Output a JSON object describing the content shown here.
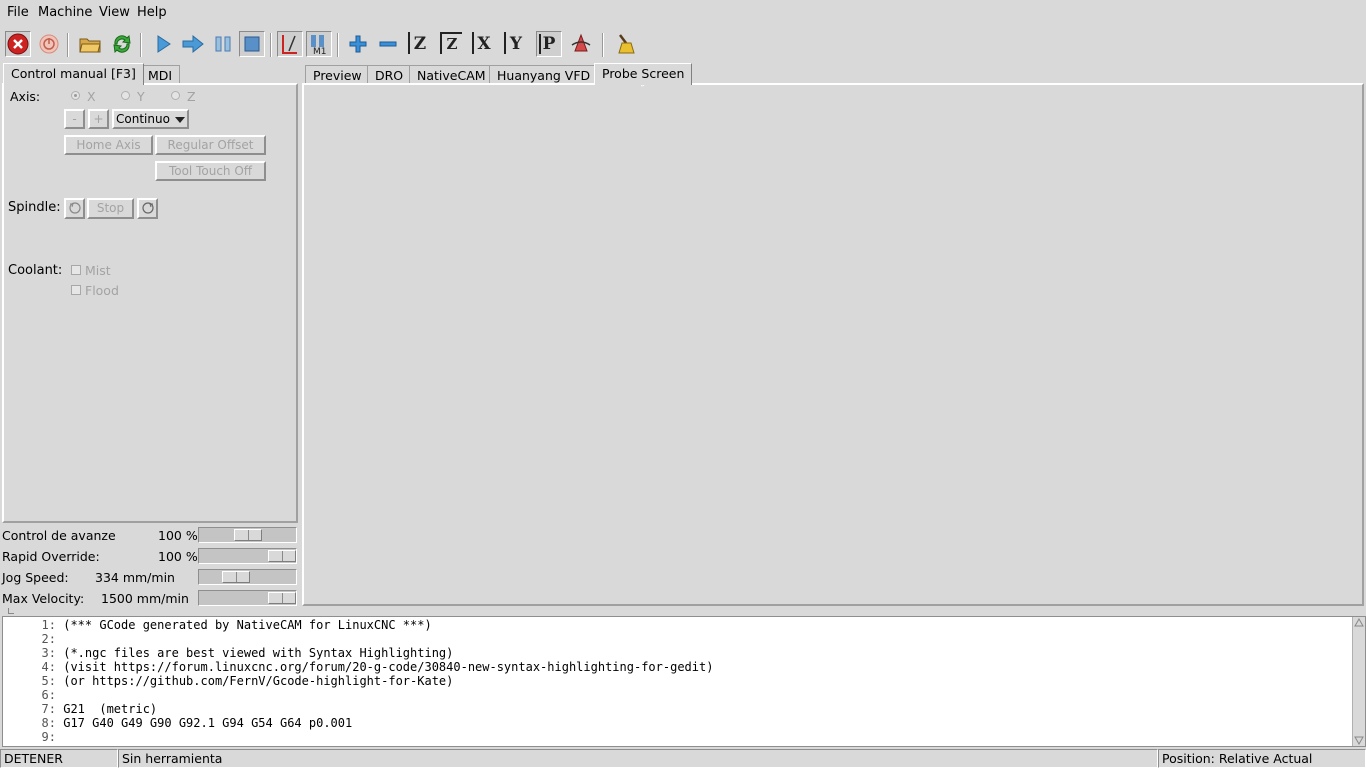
{
  "menu": [
    "File",
    "Machine",
    "View",
    "Help"
  ],
  "colors": {
    "background": "#d9d9d9",
    "estop": "#cc2222",
    "accent": "#3a8fd6"
  },
  "toolbar": {
    "icons": [
      "estop-icon",
      "power-icon",
      "open-icon",
      "reload-icon",
      "run-icon",
      "step-icon",
      "pause-icon",
      "stop-icon",
      "block-delete-icon",
      "optional-stop-icon",
      "zoom-in-icon",
      "zoom-out-icon",
      "view-z-icon",
      "view-z2-icon",
      "view-x-icon",
      "view-y-icon",
      "view-p-icon",
      "rotate-icon",
      "clear-plot-icon"
    ],
    "letters": {
      "z": "Z",
      "x": "X",
      "y": "Y",
      "p": "P",
      "m1": "M1"
    }
  },
  "left_tabs": [
    "Control manual [F3]",
    "MDI"
  ],
  "right_tabs": [
    "Preview",
    "DRO",
    "NativeCAM",
    "Huanyang VFD",
    "Probe Screen"
  ],
  "manual": {
    "axis_label": "Axis:",
    "axes": [
      "X",
      "Y",
      "Z"
    ],
    "minus": "-",
    "plus": "+",
    "jog_mode": "Continuo",
    "home_axis": "Home Axis",
    "regular_offset": "Regular Offset",
    "tool_touch_off": "Tool Touch Off",
    "spindle_label": "Spindle:",
    "stop": "Stop",
    "coolant_label": "Coolant:",
    "mist": "Mist",
    "flood": "Flood"
  },
  "overrides": [
    {
      "label": "Control de avanze",
      "value": "100 %",
      "level": 0.5
    },
    {
      "label": "Rapid Override:",
      "value": "100 %",
      "level": 1.0
    },
    {
      "label": "Jog Speed:",
      "value": "334 mm/min",
      "level": 0.33
    },
    {
      "label": "Max Velocity:",
      "value": "1500 mm/min",
      "level": 1.0
    }
  ],
  "code": [
    {
      "n": "1:",
      "text": "(*** GCode generated by NativeCAM for LinuxCNC ***)"
    },
    {
      "n": "2:",
      "text": ""
    },
    {
      "n": "3:",
      "text": "(*.ngc files are best viewed with Syntax Highlighting)"
    },
    {
      "n": "4:",
      "text": "(visit https://forum.linuxcnc.org/forum/20-g-code/30840-new-syntax-highlighting-for-gedit)"
    },
    {
      "n": "5:",
      "text": "(or https://github.com/FernV/Gcode-highlight-for-Kate)"
    },
    {
      "n": "6:",
      "text": ""
    },
    {
      "n": "7:",
      "text": "G21  (metric)"
    },
    {
      "n": "8:",
      "text": "G17 G40 G49 G90 G92.1 G94 G54 G64 p0.001"
    },
    {
      "n": "9:",
      "text": ""
    }
  ],
  "status": {
    "state": "DETENER",
    "tool": "Sin herramienta",
    "position": "Position: Relative Actual"
  }
}
